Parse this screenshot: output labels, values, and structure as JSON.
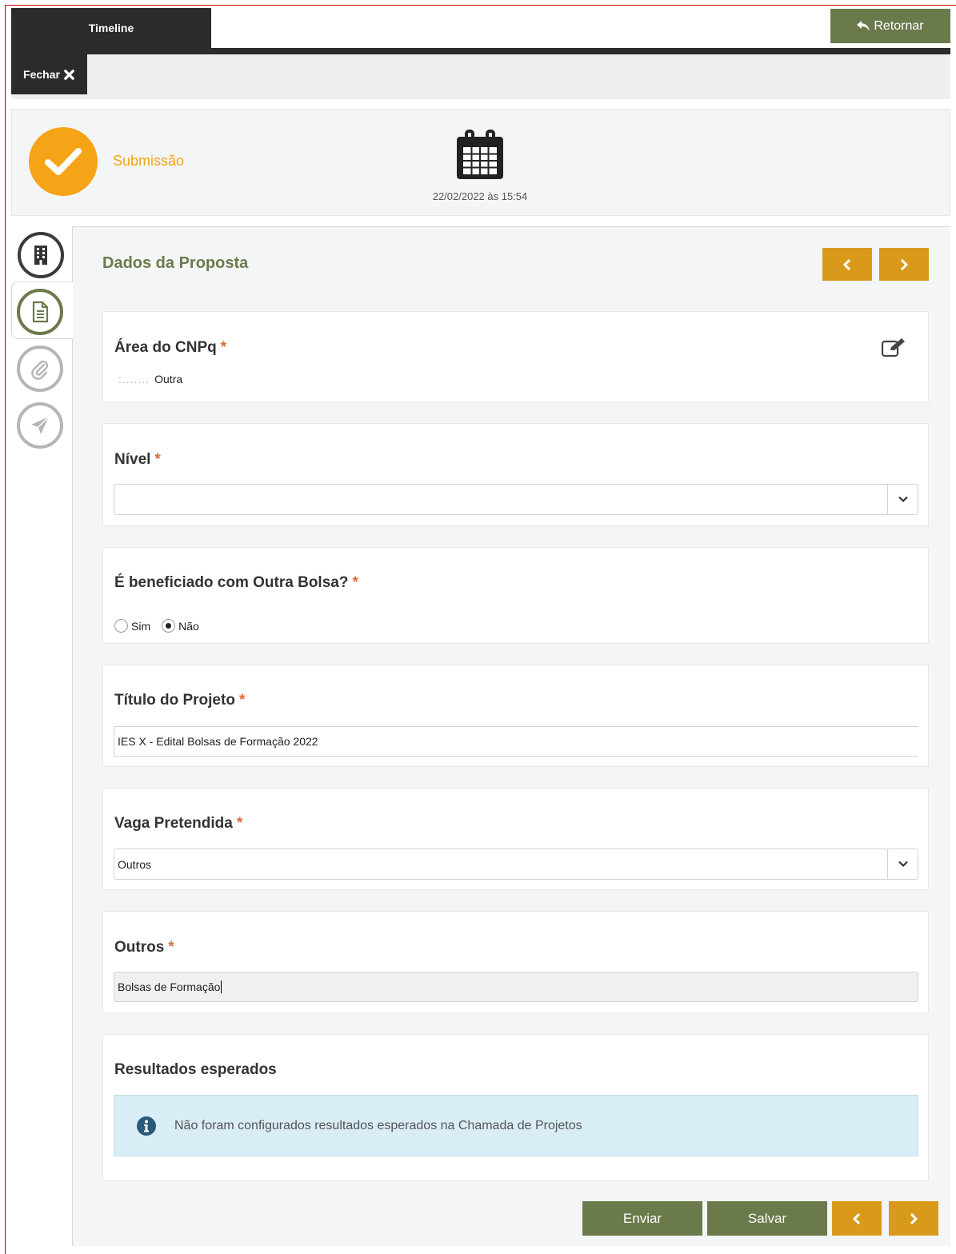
{
  "header": {
    "timeline_tab": "Timeline",
    "back_button": "Retornar",
    "close_button": "Fechar"
  },
  "submission": {
    "status_label": "Submissão",
    "date": "22/02/2022 às 15:54",
    "status_color": "#f6a417"
  },
  "nav_icons": [
    "building-icon",
    "document-icon",
    "paperclip-icon",
    "paper-plane-icon"
  ],
  "form": {
    "title": "Dados da Proposta",
    "area_cnpq": {
      "label": "Área do CNPq",
      "required_mark": "*",
      "prefix": ":.......",
      "value": "Outra"
    },
    "nivel": {
      "label": "Nível",
      "required_mark": "*",
      "value": ""
    },
    "outra_bolsa": {
      "label": "É beneficiado com Outra Bolsa?",
      "required_mark": "*",
      "options": [
        "Sim",
        "Não"
      ],
      "selected": "Não"
    },
    "titulo_projeto": {
      "label": "Título do Projeto",
      "required_mark": "*",
      "value": "IES X - Edital Bolsas de Formação 2022"
    },
    "vaga_pretendida": {
      "label": "Vaga Pretendida",
      "required_mark": "*",
      "value": "Outros"
    },
    "outros": {
      "label": "Outros",
      "required_mark": "*",
      "value": "Bolsas de Formação"
    },
    "resultados": {
      "label": "Resultados esperados",
      "info_message": "Não foram configurados resultados esperados na Chamada de Projetos"
    }
  },
  "footer": {
    "send_button": "Enviar",
    "save_button": "Salvar"
  },
  "colors": {
    "primary_olive": "#6b7a4b",
    "nav_gold": "#d99a1b",
    "dark": "#2b2b2b",
    "info_bg": "#d9edf7"
  }
}
